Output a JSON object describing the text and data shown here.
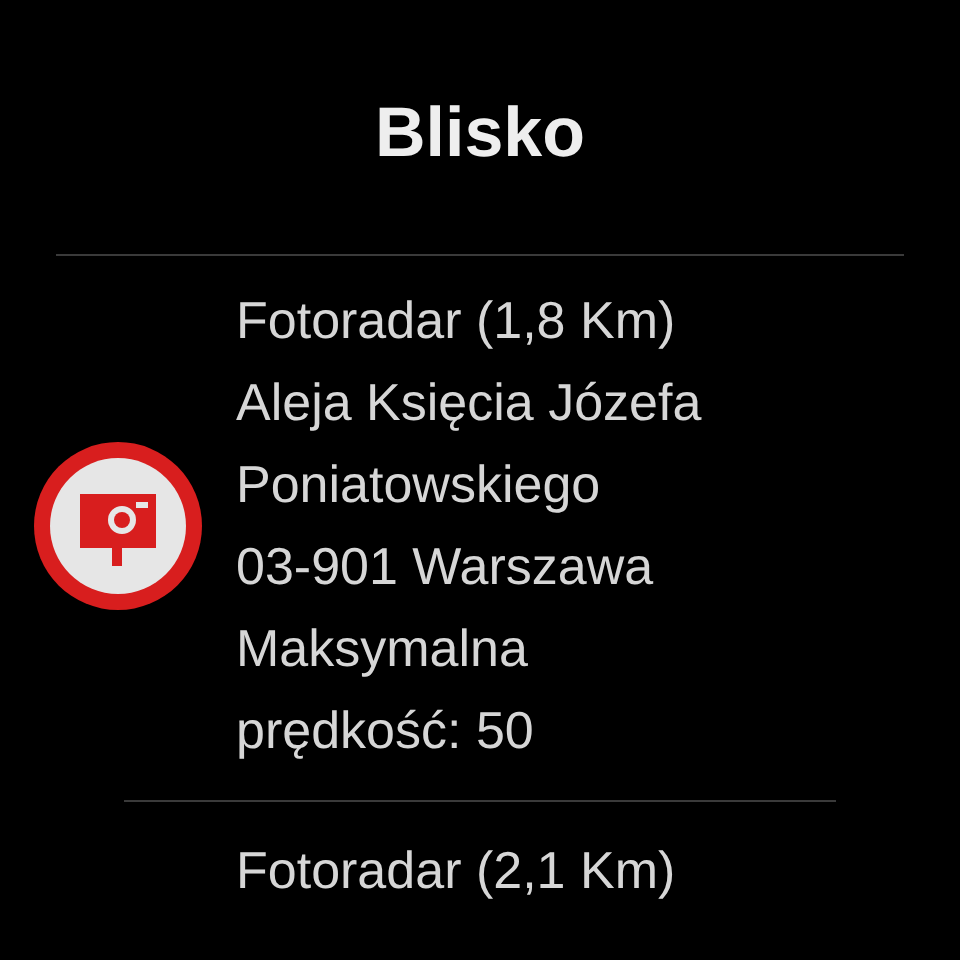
{
  "title": "Blisko",
  "items": [
    {
      "kind": "speed_camera",
      "name": "Fotoradar (1,8 Km)",
      "address": "Aleja Księcia Józefa Poniatowskiego",
      "city": "03-901 Warszawa",
      "speed": "Maksymalna prędkość: 50"
    },
    {
      "kind": "speed_camera",
      "name": "Fotoradar (2,1 Km)"
    }
  ]
}
